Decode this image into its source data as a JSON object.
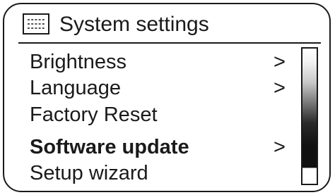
{
  "header": {
    "title": "System settings",
    "icon": "menu-grid-icon"
  },
  "menu": {
    "items": [
      {
        "label": "Brightness",
        "arrow": ">",
        "selected": false
      },
      {
        "label": "Language",
        "arrow": ">",
        "selected": false
      },
      {
        "label": "Factory Reset",
        "arrow": "",
        "selected": false
      },
      {
        "label": "Software update",
        "arrow": ">",
        "selected": true
      },
      {
        "label": "Setup wizard",
        "arrow": "",
        "selected": false
      }
    ]
  },
  "scrollbar": {
    "position_fraction": 0.75
  },
  "colors": {
    "foreground": "#1a1a1a",
    "background": "#ffffff"
  }
}
